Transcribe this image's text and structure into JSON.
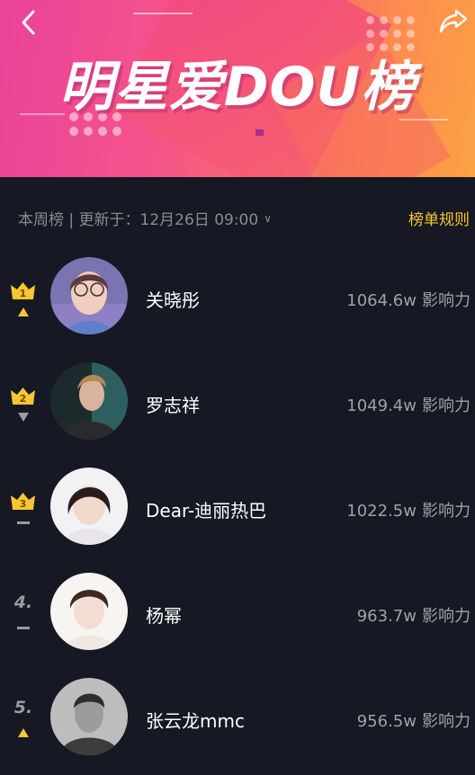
{
  "banner": {
    "title": "明星爱DOU榜",
    "back_icon": "chevron-left-icon",
    "share_icon": "share-arrow-icon"
  },
  "subheader": {
    "update_text": "本周榜 | 更新于：12月26日 09:00",
    "dropdown_icon": "chevron-down-icon",
    "rules_label": "榜单规则",
    "rules_color": "#f7c631"
  },
  "colors": {
    "background": "#161823",
    "crown_gold": "#f7c631",
    "text_secondary": "#a0a1a7"
  },
  "ranking": [
    {
      "rank": "1",
      "crown": true,
      "trend": "up",
      "name": "关晓彤",
      "score": "1064.6w",
      "unit": "影响力",
      "avatar": "avatar-photo"
    },
    {
      "rank": "2",
      "crown": true,
      "trend": "down",
      "name": "罗志祥",
      "score": "1049.4w",
      "unit": "影响力",
      "avatar": "avatar-photo"
    },
    {
      "rank": "3",
      "crown": true,
      "trend": "same",
      "name": "Dear-迪丽热巴",
      "score": "1022.5w",
      "unit": "影响力",
      "avatar": "avatar-photo"
    },
    {
      "rank": "4.",
      "crown": false,
      "trend": "same",
      "name": "杨幂",
      "score": "963.7w",
      "unit": "影响力",
      "avatar": "avatar-photo"
    },
    {
      "rank": "5.",
      "crown": false,
      "trend": "up",
      "name": "张云龙mmc",
      "score": "956.5w",
      "unit": "影响力",
      "avatar": "avatar-photo"
    }
  ]
}
